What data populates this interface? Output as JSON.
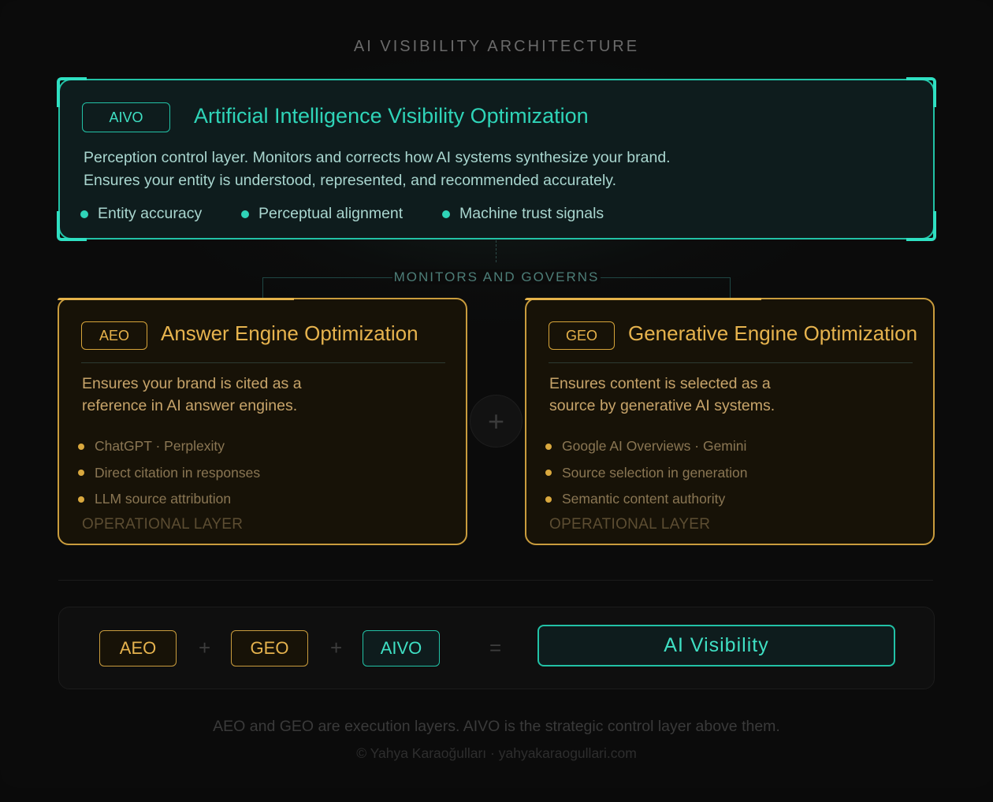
{
  "title": "AI VISIBILITY ARCHITECTURE",
  "aivo": {
    "badge": "AIVO",
    "heading": "Artificial Intelligence Visibility Optimization",
    "desc_line1": "Perception control layer. Monitors and corrects how AI systems synthesize your brand.",
    "desc_line2": "Ensures your entity is understood, represented, and recommended accurately.",
    "points": [
      "Entity accuracy",
      "Perceptual alignment",
      "Machine trust signals"
    ]
  },
  "connector_label": "MONITORS AND GOVERNS",
  "aeo": {
    "badge": "AEO",
    "heading": "Answer Engine Optimization",
    "desc_line1": "Ensures your brand is cited as a",
    "desc_line2": "reference in AI answer engines.",
    "items": [
      "ChatGPT · Perplexity",
      "Direct citation in responses",
      "LLM source attribution"
    ],
    "layer": "OPERATIONAL LAYER"
  },
  "geo": {
    "badge": "GEO",
    "heading": "Generative Engine Optimization",
    "desc_line1": "Ensures content is selected as a",
    "desc_line2": "source by generative AI systems.",
    "items": [
      "Google AI Overviews · Gemini",
      "Source selection in generation",
      "Semantic content authority"
    ],
    "layer": "OPERATIONAL LAYER"
  },
  "plus_symbol": "+",
  "equation": {
    "terms": [
      "AEO",
      "GEO",
      "AIVO"
    ],
    "plus": "+",
    "equals": "=",
    "result": "AI Visibility"
  },
  "footnote": "AEO and GEO are execution layers. AIVO is the strategic control layer above them.",
  "credit": "© Yahya Karaoğulları · yahyakaraogullari.com",
  "colors": {
    "teal": "#22c2a6",
    "gold": "#c99c3d",
    "background": "#0b0b0b"
  }
}
